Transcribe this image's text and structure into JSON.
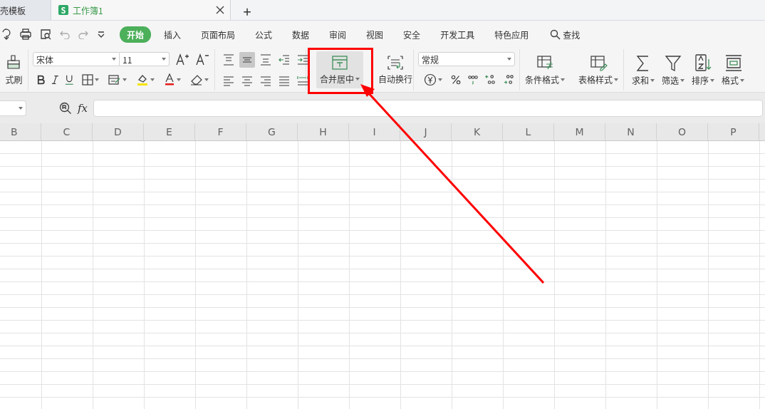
{
  "tabs": [
    {
      "label": "壳模板",
      "selected": false
    },
    {
      "label": "工作簿1",
      "selected": true,
      "icon_letter": "S"
    }
  ],
  "new_tab": "+",
  "menu": [
    {
      "label": "开始",
      "selected": true
    },
    {
      "label": "插入",
      "selected": false
    },
    {
      "label": "页面布局",
      "selected": false
    },
    {
      "label": "公式",
      "selected": false
    },
    {
      "label": "数据",
      "selected": false
    },
    {
      "label": "审阅",
      "selected": false
    },
    {
      "label": "视图",
      "selected": false
    },
    {
      "label": "安全",
      "selected": false
    },
    {
      "label": "开发工具",
      "selected": false
    },
    {
      "label": "特色应用",
      "selected": false
    }
  ],
  "search": {
    "label": "查找"
  },
  "ribbon": {
    "format_painter": "式刷",
    "font": "宋体",
    "font_size": "11",
    "alignment": [
      {
        "kind": "top",
        "selected": false
      },
      {
        "kind": "middle",
        "selected": true
      },
      {
        "kind": "bottom",
        "selected": false
      },
      {
        "kind": "outdent",
        "selected": false
      },
      {
        "kind": "indent",
        "selected": false
      },
      {
        "kind": "left",
        "selected": false
      },
      {
        "kind": "center",
        "selected": false
      },
      {
        "kind": "right",
        "selected": false
      },
      {
        "kind": "justify",
        "selected": false
      },
      {
        "kind": "distribute",
        "selected": false
      }
    ],
    "merge": {
      "label": "合并居中",
      "hovered": true
    },
    "wrap": "自动换行",
    "number_format": "常规",
    "styles": [
      {
        "label": "条件格式",
        "kind": "conditional"
      },
      {
        "label": "表格样式",
        "kind": "table"
      }
    ],
    "tools": [
      {
        "label": "求和",
        "kind": "sum"
      },
      {
        "label": "筛选",
        "kind": "filter"
      },
      {
        "label": "排序",
        "kind": "sort"
      },
      {
        "label": "格式",
        "kind": "format"
      }
    ]
  },
  "formula_bar": {
    "fx": "fx"
  },
  "columns": [
    "B",
    "C",
    "D",
    "E",
    "F",
    "G",
    "H",
    "I",
    "J",
    "K",
    "L",
    "M",
    "N",
    "O",
    "P"
  ]
}
